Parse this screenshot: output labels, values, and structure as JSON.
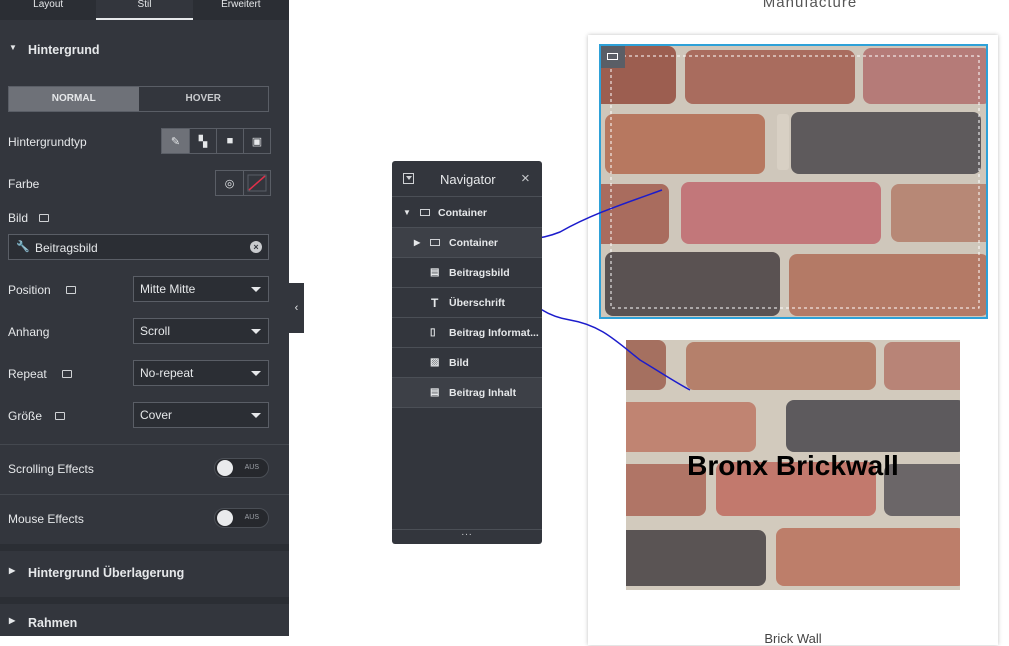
{
  "panel": {
    "tabs": [
      "Layout",
      "Stil",
      "Erweitert"
    ],
    "section_title": "Hintergrund",
    "state_tabs": [
      "NORMAL",
      "HOVER"
    ],
    "background_type_label": "Hintergrundtyp",
    "color_label": "Farbe",
    "image_label": "Bild",
    "image_value": "Beitragsbild",
    "position_label": "Position",
    "position_value": "Mitte Mitte",
    "attachment_label": "Anhang",
    "attachment_value": "Scroll",
    "repeat_label": "Repeat",
    "repeat_value": "No-repeat",
    "size_label": "Größe",
    "size_value": "Cover",
    "scrolling_effects_label": "Scrolling Effects",
    "scrolling_effects_state": "AUS",
    "mouse_effects_label": "Mouse Effects",
    "mouse_effects_state": "AUS",
    "overlay_section": "Hintergrund Überlagerung",
    "border_section": "Rahmen"
  },
  "navigator": {
    "title": "Navigator",
    "close": "×",
    "footer": "...",
    "items": [
      {
        "label": "Container"
      },
      {
        "label": "Container"
      },
      {
        "label": "Beitragsbild"
      },
      {
        "label": "Überschrift"
      },
      {
        "label": "Beitrag Informat..."
      },
      {
        "label": "Bild"
      },
      {
        "label": "Beitrag Inhalt"
      }
    ]
  },
  "canvas": {
    "top_text": "Manufacture",
    "image_caption": "Bronx Brickwall",
    "bottom_text": "Brick Wall"
  },
  "colors": {
    "panel_bg": "#33363d",
    "accent_border": "#2ea1d8",
    "annotation_line": "#1c1ccc"
  }
}
